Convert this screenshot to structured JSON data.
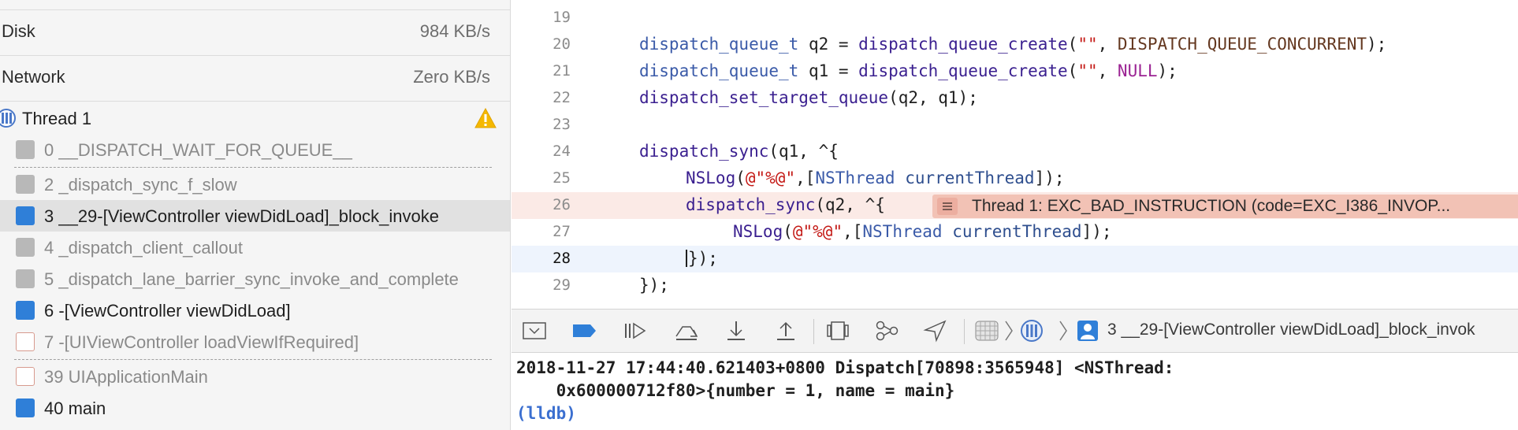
{
  "navigator": {
    "gauges": [
      {
        "label": "Disk",
        "value": "984 KB/s"
      },
      {
        "label": "Network",
        "value": "Zero KB/s"
      }
    ],
    "thread": {
      "label": "Thread 1",
      "icon": "thread-icon",
      "warning_icon": "warning-icon",
      "warning_color": "#f5b800"
    },
    "frames": [
      {
        "text": "0 __DISPATCH_WAIT_FOR_QUEUE__",
        "icon": "gear-icon"
      },
      {
        "text": "2 _dispatch_sync_f_slow",
        "icon": "gear-icon"
      },
      {
        "text": "3 __29-[ViewController viewDidLoad]_block_invoke",
        "icon": "user-icon",
        "selected": true
      },
      {
        "text": "4 _dispatch_client_callout",
        "icon": "gear-icon"
      },
      {
        "text": "5 _dispatch_lane_barrier_sync_invoke_and_complete",
        "icon": "gear-icon"
      },
      {
        "text": "6 -[ViewController viewDidLoad]",
        "icon": "user-icon"
      },
      {
        "text": "7 -[UIViewController loadViewIfRequired]",
        "icon": "frame-icon"
      },
      {
        "text": "39 UIApplicationMain",
        "icon": "frame-icon"
      },
      {
        "text": "40 main",
        "icon": "user-icon"
      }
    ]
  },
  "editor": {
    "lines": [
      {
        "n": "19",
        "text": ""
      },
      {
        "n": "20",
        "text": "dispatch_queue_t q2 = dispatch_queue_create(\"\", DISPATCH_QUEUE_CONCURRENT);"
      },
      {
        "n": "21",
        "text": "dispatch_queue_t q1 = dispatch_queue_create(\"\", NULL);"
      },
      {
        "n": "22",
        "text": "dispatch_set_target_queue(q2, q1);"
      },
      {
        "n": "23",
        "text": ""
      },
      {
        "n": "24",
        "text": "dispatch_sync(q1, ^{"
      },
      {
        "n": "25",
        "text": "NSLog(@\"%@\",[NSThread currentThread]);"
      },
      {
        "n": "26",
        "text": "dispatch_sync(q2, ^{"
      },
      {
        "n": "27",
        "text": "NSLog(@\"%@\",[NSThread currentThread]);"
      },
      {
        "n": "28",
        "text": "});"
      },
      {
        "n": "29",
        "text": "});"
      }
    ],
    "error_banner": "Thread 1: EXC_BAD_INSTRUCTION (code=EXC_I386_INVOP...",
    "error_color": "#f2c2b5",
    "current_line_color": "#eef4fd"
  },
  "debugbar": {
    "breakpoint_color": "#2f7fd8",
    "buttons": [
      "hide-console-icon",
      "breakpoints-toggle-icon",
      "continue-icon",
      "step-over-icon",
      "step-into-icon",
      "step-out-icon",
      "view-debugger-icon",
      "memory-graph-icon",
      "location-icon"
    ],
    "breadcrumb": "3 __29-[ViewController viewDidLoad]_block_invok"
  },
  "console": {
    "line1": "2018-11-27 17:44:40.621403+0800 Dispatch[70898:3565948] <NSThread:",
    "line2": "    0x600000712f80>{number = 1, name = main}",
    "prompt": "(lldb)"
  }
}
